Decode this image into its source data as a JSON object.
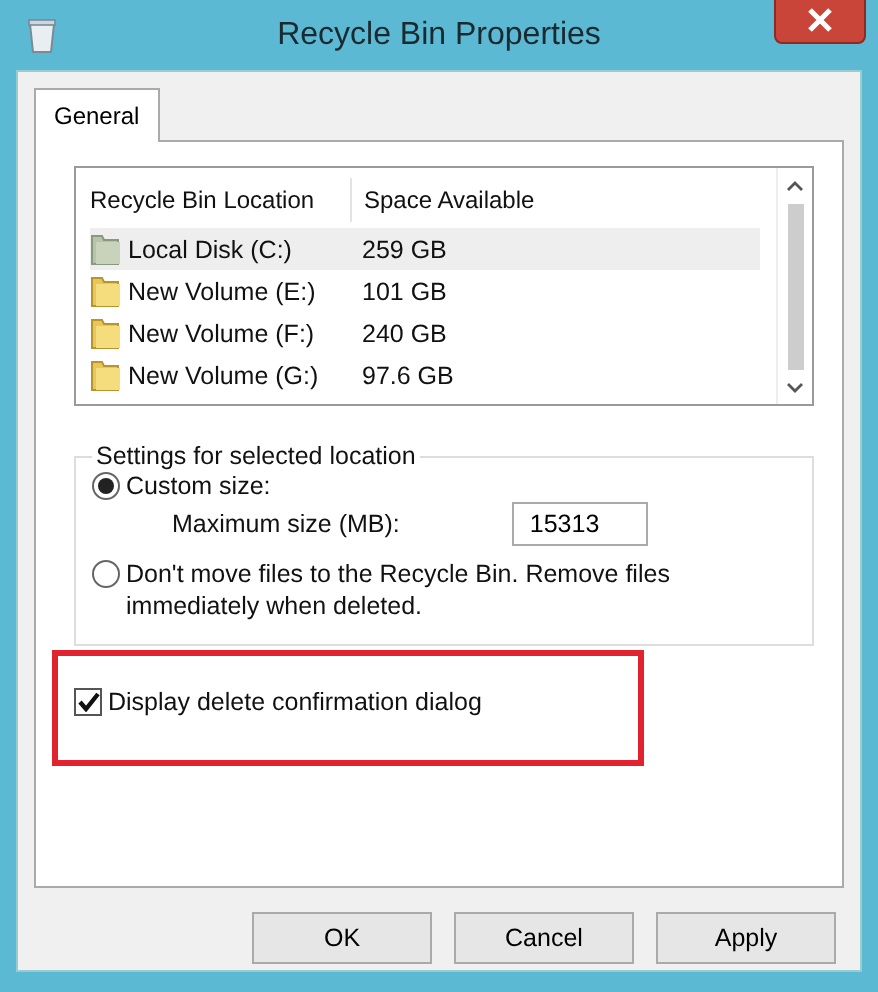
{
  "window": {
    "title": "Recycle Bin Properties"
  },
  "tabs": [
    {
      "label": "General",
      "selected": true
    }
  ],
  "locations": {
    "columns": [
      "Recycle Bin Location",
      "Space Available"
    ],
    "rows": [
      {
        "location": "Local Disk (C:)",
        "space": "259 GB",
        "selected": true
      },
      {
        "location": "New Volume (E:)",
        "space": "101 GB",
        "selected": false
      },
      {
        "location": "New Volume (F:)",
        "space": "240 GB",
        "selected": false
      },
      {
        "location": "New Volume (G:)",
        "space": "97.6 GB",
        "selected": false
      }
    ]
  },
  "settings": {
    "title": "Settings for selected location",
    "options": [
      {
        "label": "Custom size:",
        "selected": true,
        "field": {
          "label": "Maximum size (MB):",
          "value": "15313"
        }
      },
      {
        "label": "Don't move files to the Recycle Bin. Remove files immediately when deleted.",
        "selected": false
      }
    ]
  },
  "confirm": {
    "label": "Display delete confirmation dialog",
    "checked": true
  },
  "buttons": [
    "OK",
    "Cancel",
    "Apply"
  ]
}
